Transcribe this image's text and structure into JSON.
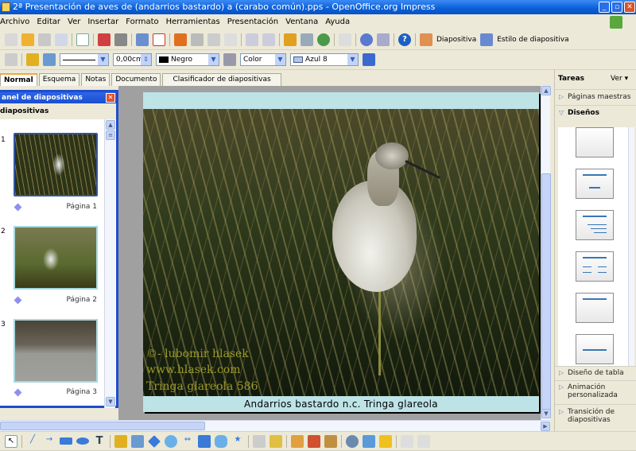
{
  "window": {
    "title": "2ª Presentación  de aves de (andarrios bastardo) a (carabo común).pps - OpenOffice.org Impress"
  },
  "menu": [
    "Archivo",
    "Editar",
    "Ver",
    "Insertar",
    "Formato",
    "Herramientas",
    "Presentación",
    "Ventana",
    "Ayuda"
  ],
  "toolbar": {
    "slide_button": "Diapositiva",
    "slide_style_button": "Estilo de diapositiva"
  },
  "line_toolbar": {
    "line_width": "0,00cm",
    "line_color": "Negro",
    "area_style": "Color",
    "area_color": "Azul 8",
    "line_color_hex": "#000000",
    "area_color_hex": "#a6caf0"
  },
  "view_tabs": [
    "Normal",
    "Esquema",
    "Notas",
    "Documento",
    "Clasificador de diapositivas"
  ],
  "slide_panel": {
    "title": "anel de diapositivas",
    "subtitle": "diapositivas",
    "slides": [
      {
        "number": "1",
        "label": "Página 1"
      },
      {
        "number": "2",
        "label": "Página 2"
      },
      {
        "number": "3",
        "label": "Página 3"
      }
    ]
  },
  "slide": {
    "watermark": [
      "©- lubomir hlasek",
      "www.hlasek.com",
      "Tringa glareola 586"
    ],
    "caption": "Andarrios bastardo  n.c. Tringa glareola"
  },
  "task_pane": {
    "title": "Tareas",
    "view_menu": "Ver",
    "sections": {
      "master": "Páginas maestras",
      "layouts": "Diseños",
      "table": "Diseño de tabla",
      "animation": "Animación personalizada",
      "transition": "Transición de diapositivas"
    }
  }
}
